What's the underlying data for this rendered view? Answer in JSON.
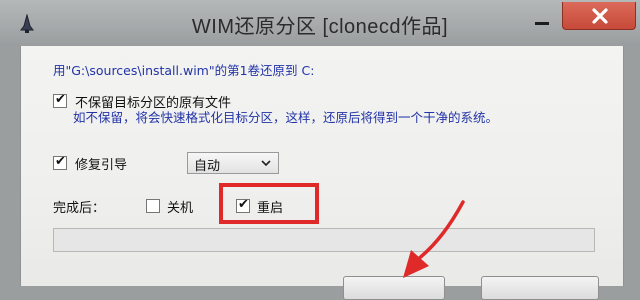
{
  "window": {
    "title": "WIM还原分区 [clonecd作品]"
  },
  "main": {
    "path_line": "用\"G:\\sources\\install.wim\"的第1卷还原到 C:",
    "keep_files": {
      "label": "不保留目标分区的原有文件",
      "checked": true,
      "description": "如不保留，将会快速格式化目标分区，这样，还原后将得到一个干净的系统。"
    },
    "repair_boot": {
      "label": "修复引导",
      "checked": true,
      "mode_value": "自动"
    },
    "after_complete": {
      "label": "完成后：",
      "shutdown": {
        "label": "关机",
        "checked": false
      },
      "restart": {
        "label": "重启",
        "checked": true
      }
    },
    "progress": {
      "value": 0
    }
  },
  "colors": {
    "info_text": "#2233a8",
    "highlight": "#e02a2a",
    "close_button": "#c64a39"
  },
  "icons": {
    "app": "app-icon",
    "minimize": "minimize-icon",
    "close": "close-icon",
    "dropdown": "chevron-down-icon",
    "check": "checkmark-icon",
    "annotation": "arrow-annotation-icon"
  }
}
